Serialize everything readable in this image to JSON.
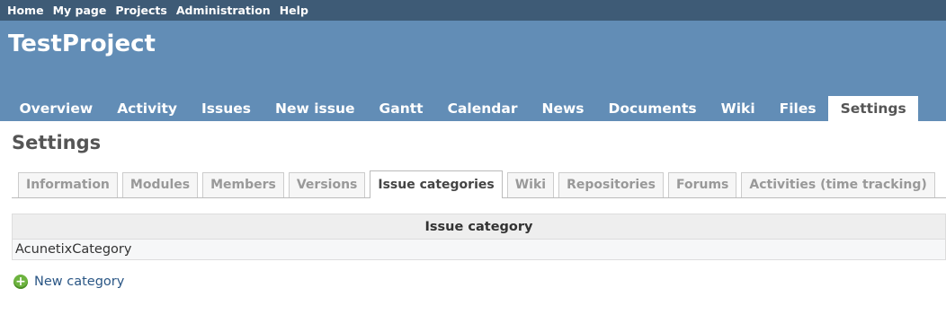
{
  "top_menu": [
    "Home",
    "My page",
    "Projects",
    "Administration",
    "Help"
  ],
  "project_title": "TestProject",
  "main_menu": [
    "Overview",
    "Activity",
    "Issues",
    "New issue",
    "Gantt",
    "Calendar",
    "News",
    "Documents",
    "Wiki",
    "Files",
    "Settings"
  ],
  "main_menu_selected": "Settings",
  "page_title": "Settings",
  "tabs": [
    "Information",
    "Modules",
    "Members",
    "Versions",
    "Issue categories",
    "Wiki",
    "Repositories",
    "Forums",
    "Activities (time tracking)"
  ],
  "tabs_selected": "Issue categories",
  "table": {
    "header": "Issue category",
    "rows": [
      "AcunetixCategory"
    ]
  },
  "new_category_label": "New category",
  "colors": {
    "top_menu_bg": "#3e5b76",
    "header_bg": "#628db6",
    "link": "#2a5685"
  }
}
